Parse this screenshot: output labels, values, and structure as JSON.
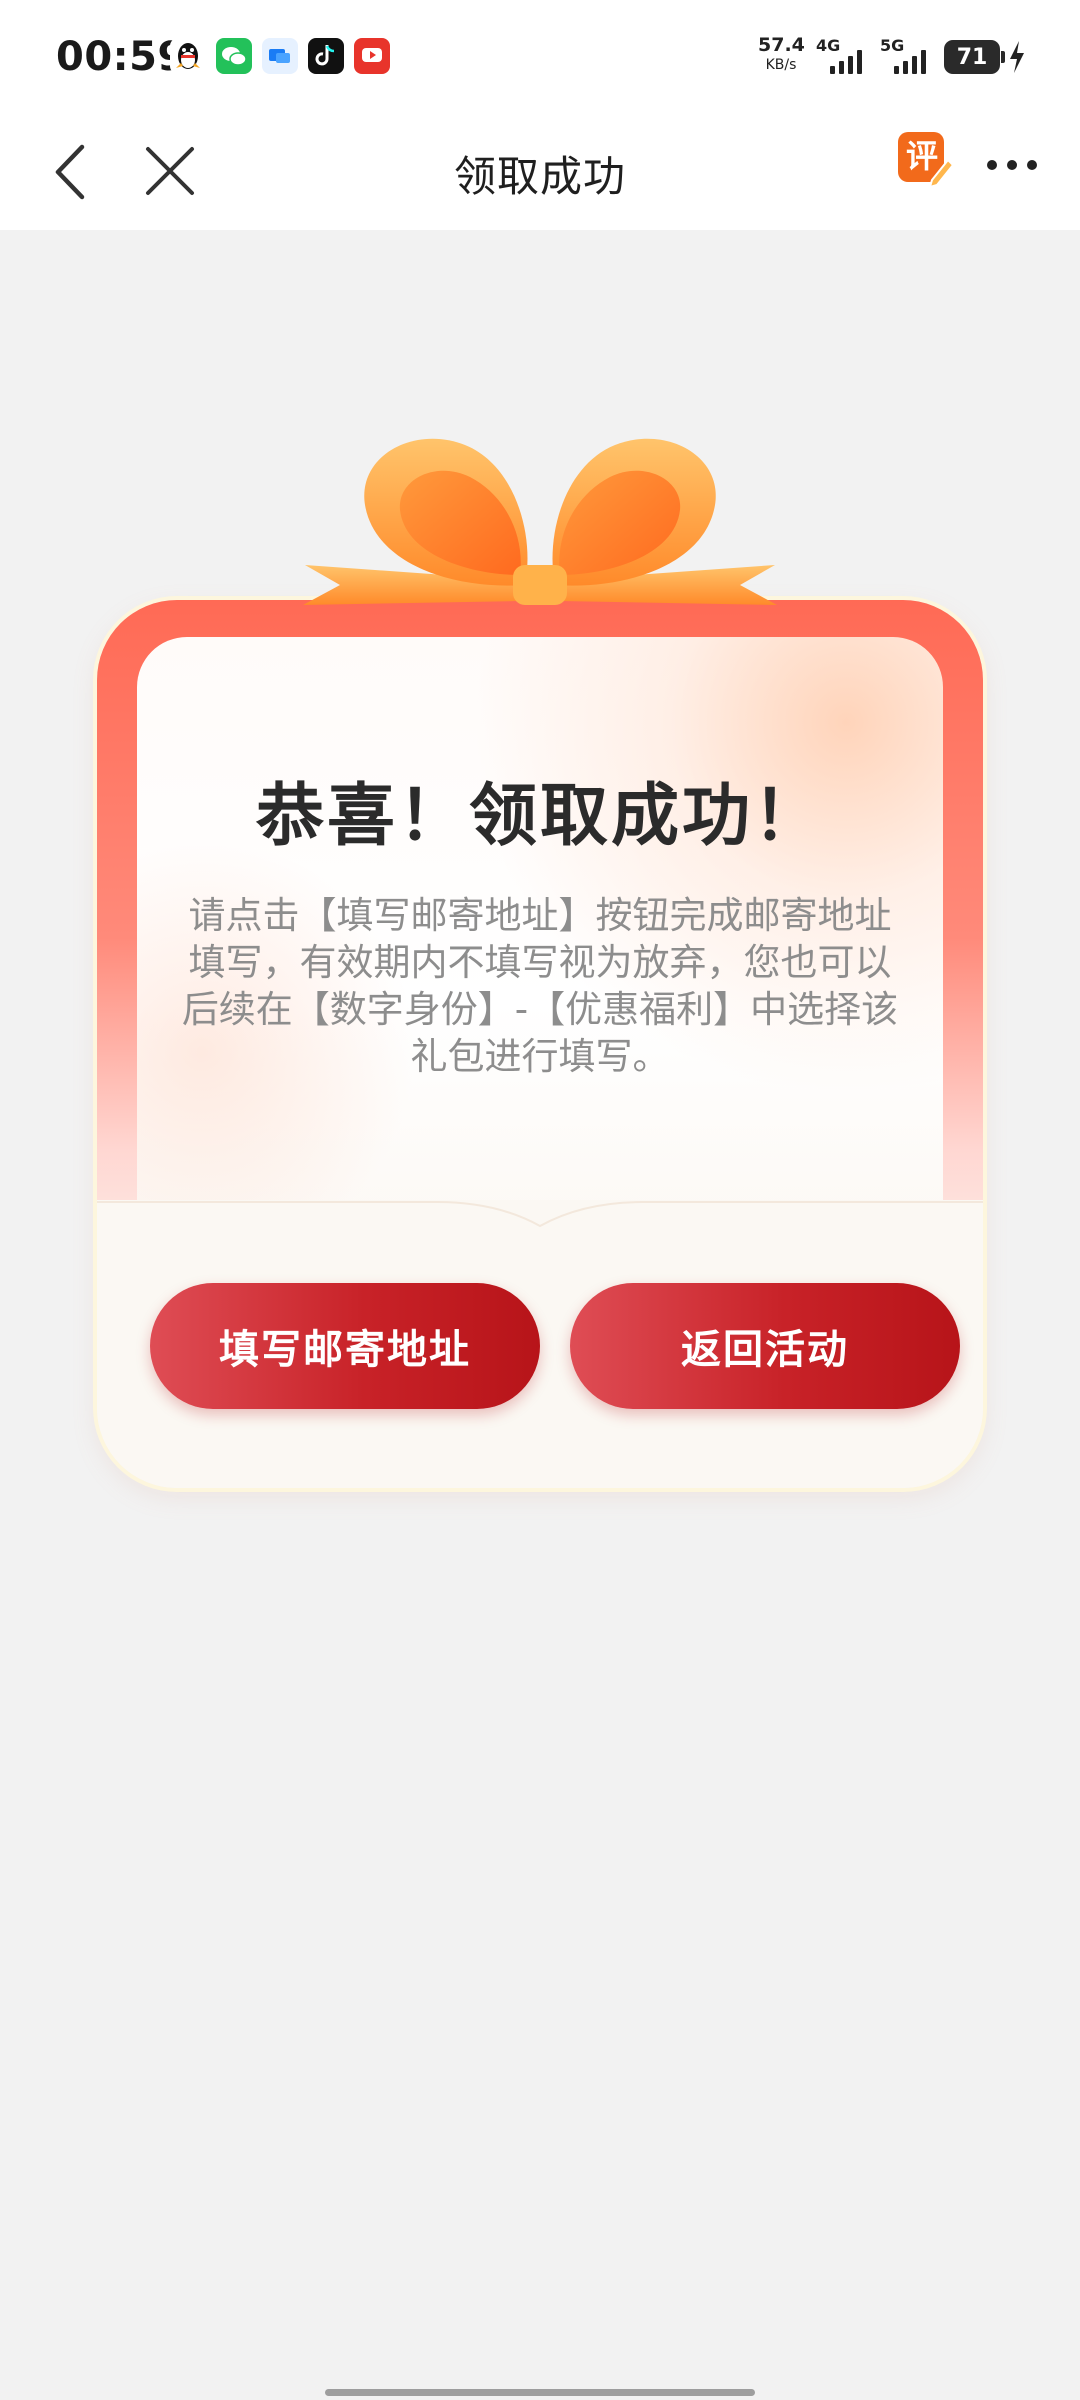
{
  "status_bar": {
    "time": "00:59",
    "app_icons": [
      "qq-icon",
      "wechat-icon",
      "messages-icon",
      "tiktok-icon",
      "video-app-icon"
    ],
    "net_speed_value": "57.4",
    "net_speed_unit": "KB/s",
    "signal_1_label": "4G",
    "signal_2_label": "5G",
    "battery": "71"
  },
  "nav": {
    "title": "领取成功",
    "rate_label": "评"
  },
  "card": {
    "title": "恭喜！领取成功！",
    "description": "请点击【填写邮寄地址】按钮完成邮寄地址填写，有效期内不填写视为放弃，您也可以后续在【数字身份】-【优惠福利】中选择该礼包进行填写。",
    "primary_button": "填写邮寄地址",
    "secondary_button": "返回活动"
  },
  "colors": {
    "button_red": "#c82228",
    "card_top_red": "#ff6a55",
    "ribbon_orange": "#ff9a3c",
    "rate_badge_orange": "#f26a1b",
    "page_background": "#f2f2f2"
  }
}
